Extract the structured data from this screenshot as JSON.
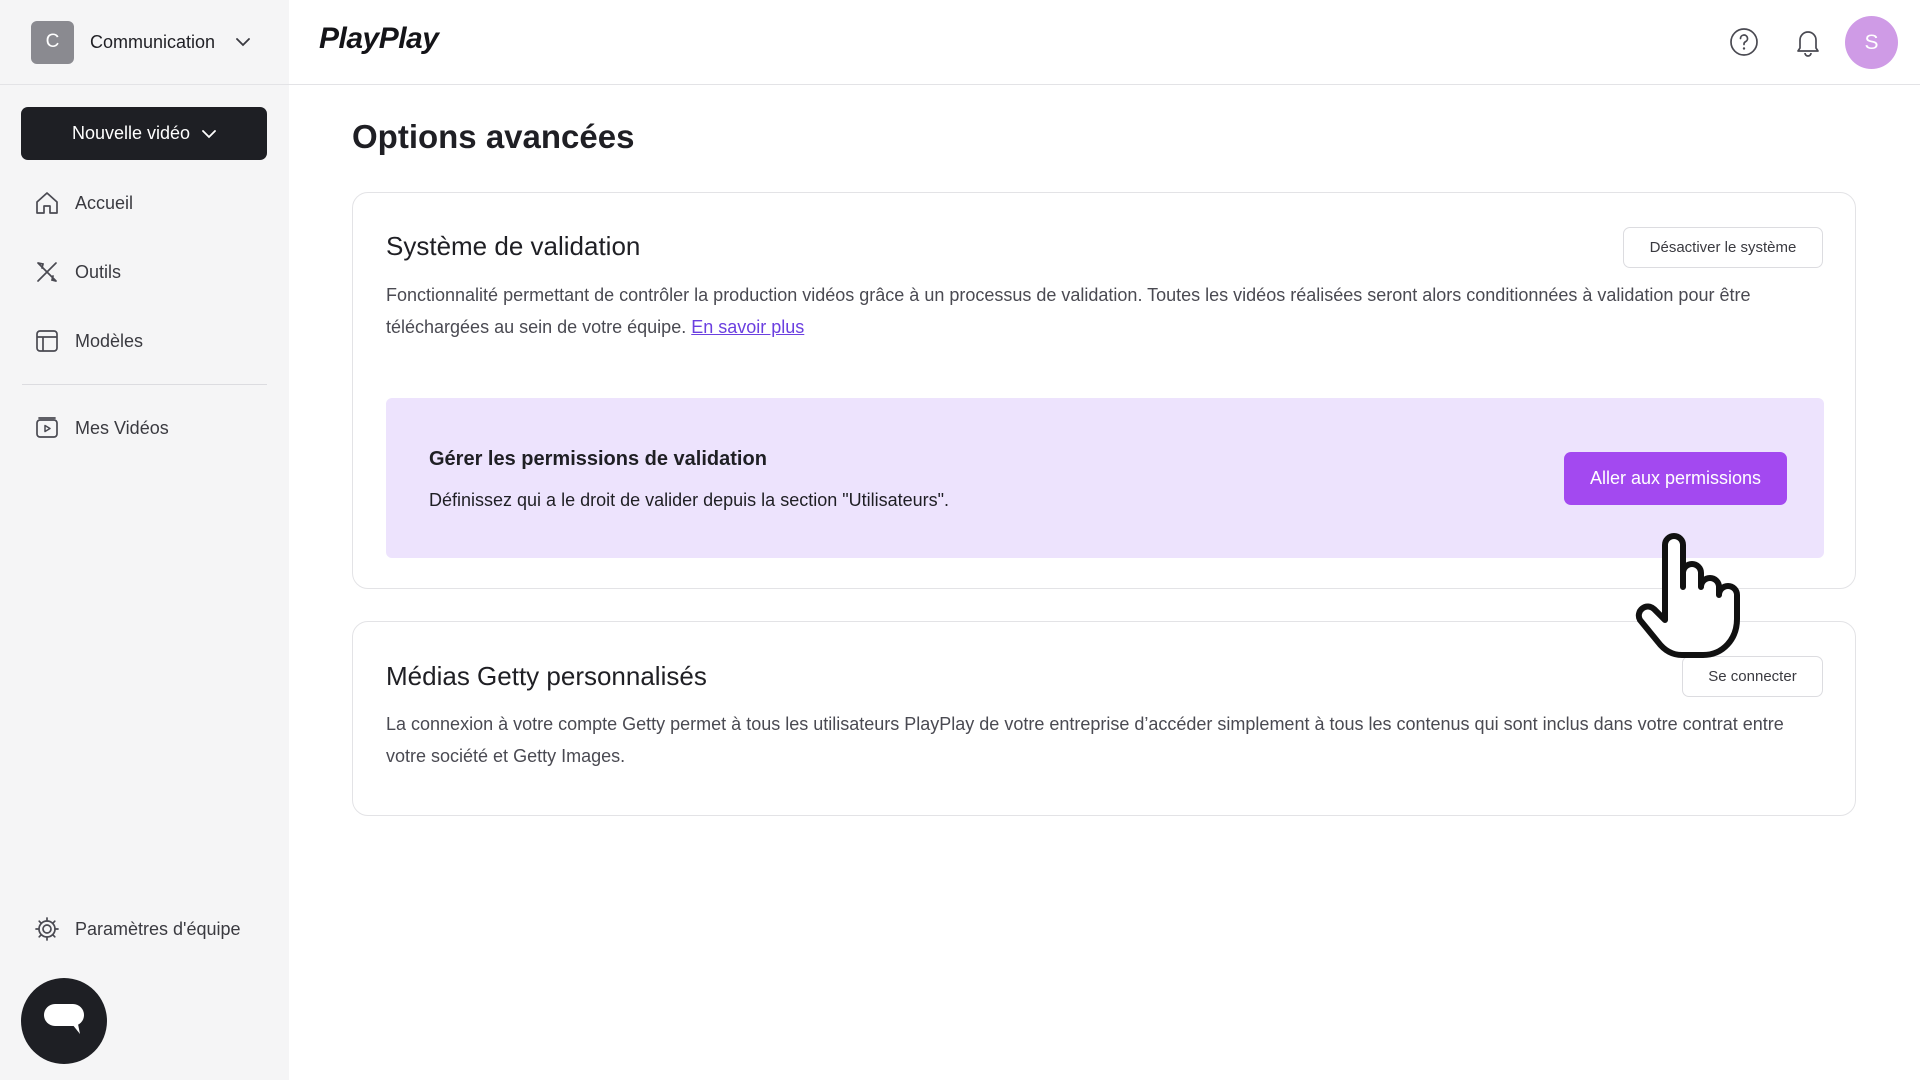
{
  "workspace": {
    "initial": "C",
    "name": "Communication"
  },
  "sidebar": {
    "new_video_label": "Nouvelle vidéo",
    "items": [
      {
        "label": "Accueil",
        "icon": "home-icon"
      },
      {
        "label": "Outils",
        "icon": "tools-icon"
      },
      {
        "label": "Modèles",
        "icon": "templates-icon"
      },
      {
        "label": "Mes Vidéos",
        "icon": "video-icon"
      }
    ],
    "settings_label": "Paramètres d'équipe"
  },
  "header": {
    "logo": "PlayPlay",
    "user_initial": "S"
  },
  "main": {
    "title": "Options avancées",
    "validation": {
      "title": "Système de validation",
      "disable_label": "Désactiver le système",
      "description": "Fonctionnalité permettant de contrôler la production vidéos grâce à un processus de validation. Toutes les vidéos réalisées seront alors conditionnées à validation pour être téléchargées au sein de votre équipe.",
      "learn_more": "En savoir plus",
      "permissions": {
        "title": "Gérer les permissions de validation",
        "description": "Définissez qui a le droit de valider depuis la section \"Utilisateurs\".",
        "button_label": "Aller aux permissions"
      }
    },
    "getty": {
      "title": "Médias Getty personnalisés",
      "connect_label": "Se connecter",
      "description": "La connexion à votre compte Getty permet à tous les utilisateurs PlayPlay de votre entreprise d’accéder simplement à tous les contenus qui sont inclus dans votre contrat entre votre société et Getty Images."
    }
  },
  "colors": {
    "primary": "#a349f0",
    "permission_bg": "#ede3fd",
    "dark": "#1e1f24",
    "avatar": "#cf9be6",
    "link": "#6b3fe0"
  }
}
